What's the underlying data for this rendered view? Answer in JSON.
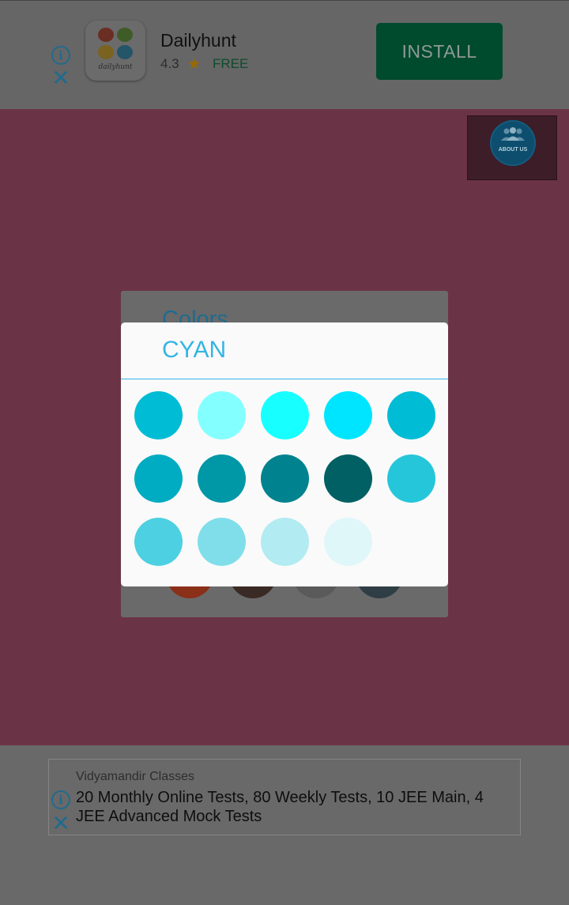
{
  "top_ad": {
    "app_name": "Dailyhunt",
    "app_logo_text": "dailyhunt",
    "rating": "4.3",
    "star": "★",
    "price": "FREE",
    "install_label": "INSTALL",
    "info_glyph": "i",
    "close_glyph": "✕"
  },
  "about_us": {
    "label": "ABOUT US"
  },
  "colors_dialog": {
    "title": "Colors",
    "visible_swatches": [
      "#8a2f18",
      "#3a2a26",
      "#5a5a5a",
      "#2f3d45"
    ]
  },
  "cyan_dialog": {
    "title": "CYAN",
    "swatches": [
      "#00BCD4",
      "#84FFFF",
      "#18FFFF",
      "#00E5FF",
      "#00BCD4",
      "#00ACC1",
      "#0097A7",
      "#00838F",
      "#006064",
      "#26C6DA",
      "#4DD0E1",
      "#80DEEA",
      "#B2EBF2",
      "#E0F7FA"
    ]
  },
  "bottom_ad": {
    "advertiser": "Vidyamandir Classes",
    "headline": "20 Monthly Online Tests, 80 Weekly Tests, 10 JEE Main, 4 JEE Advanced Mock Tests",
    "info_glyph": "i",
    "close_glyph": "✕"
  },
  "colors": {
    "overlay_main": "#6b3446",
    "dialog_title_accent": "#33b5e5",
    "install_button": "#004a2e"
  }
}
